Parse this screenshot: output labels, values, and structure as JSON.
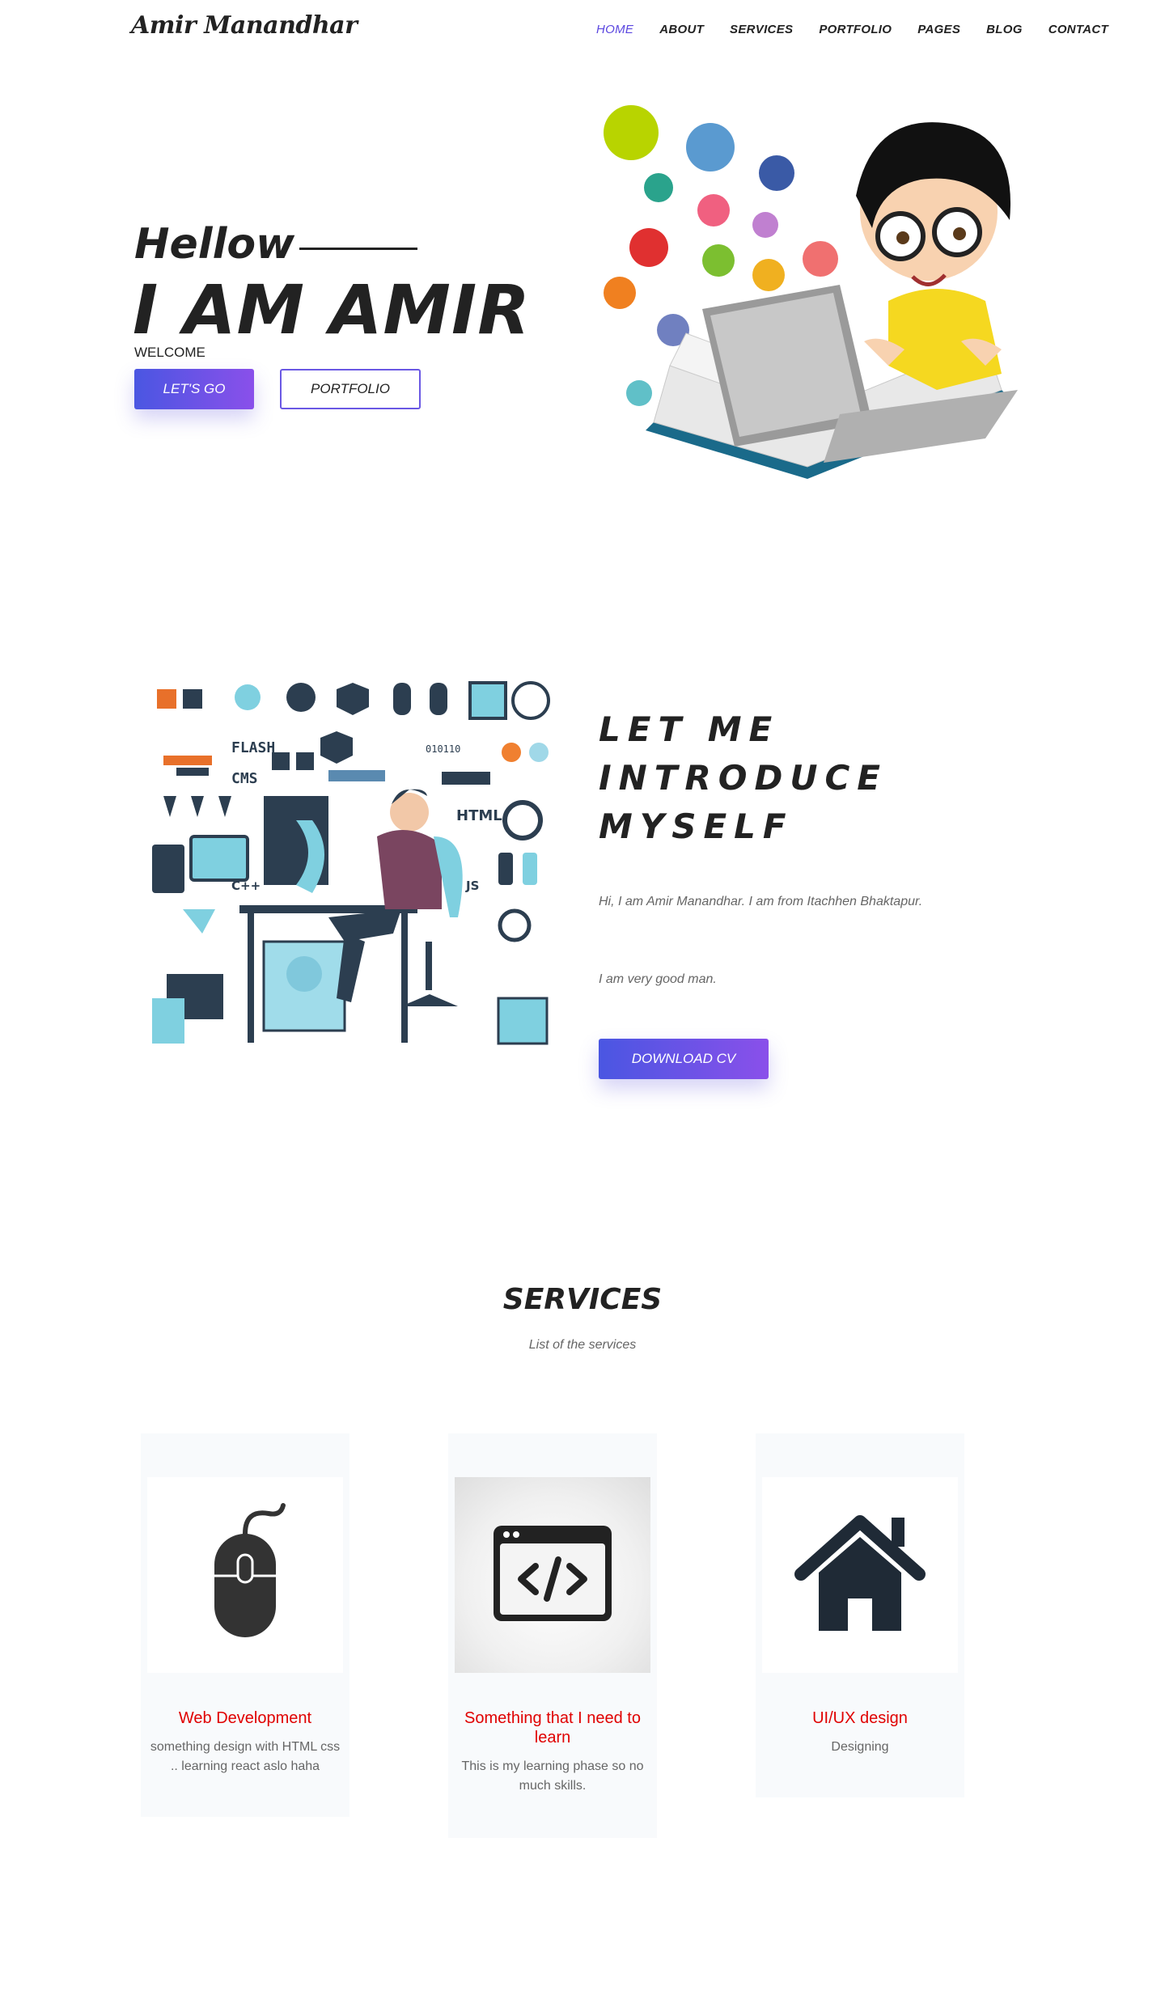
{
  "nav": {
    "logo": "Amir Manandhar",
    "items": [
      "HOME",
      "ABOUT",
      "SERVICES",
      "PORTFOLIO",
      "PAGES",
      "BLOG",
      "CONTACT"
    ],
    "active": "HOME"
  },
  "hero": {
    "hello": "Hellow",
    "title": "I AM AMIR",
    "welcome": "WELCOME",
    "btn_primary": "LET'S GO",
    "btn_secondary": "PORTFOLIO"
  },
  "about": {
    "title_lines": [
      "LET ME",
      "INTRODUCE",
      "MYSELF"
    ],
    "p1": "Hi, I am Amir Manandhar. I am from Itachhen Bhaktapur.",
    "p2": "I am very good man.",
    "btn": "DOWNLOAD CV"
  },
  "services": {
    "title": "SERVICES",
    "subtitle": "List of the services",
    "cards": [
      {
        "title": "Web Development",
        "text": "something design with HTML css .. learning react aslo haha",
        "icon": "mouse-icon"
      },
      {
        "title": "Something that I need to learn",
        "text": "This is my learning phase so no much skills.",
        "icon": "code-window-icon"
      },
      {
        "title": "UI/UX design",
        "text": "Designing",
        "icon": "house-icon"
      }
    ]
  },
  "colors": {
    "accent": "#5b47e0",
    "gradient_start": "#4a56e2",
    "gradient_end": "#8a50ea",
    "card_title": "#e00000"
  }
}
